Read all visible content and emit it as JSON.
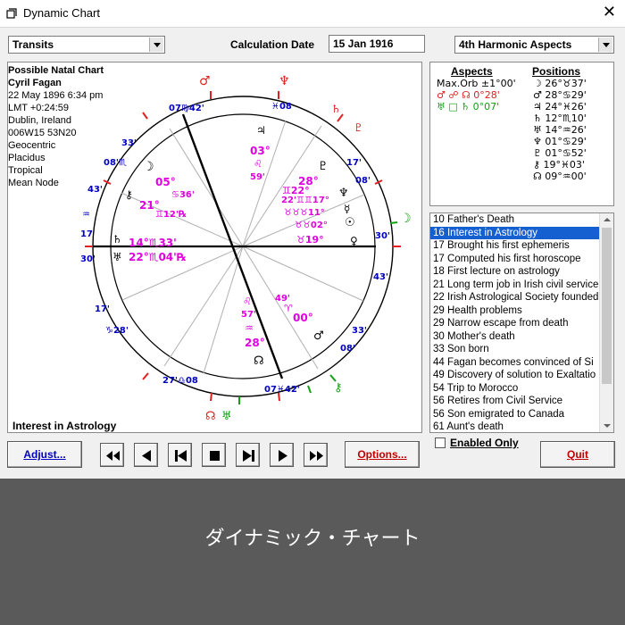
{
  "window": {
    "title": "Dynamic Chart",
    "close": "✕"
  },
  "toolbar": {
    "chart_type": "Transits",
    "calc_date_label": "Calculation Date",
    "calc_date_value": "15 Jan 1916",
    "aspect_mode": "4th Harmonic Aspects"
  },
  "chart_info": {
    "heading": "Possible Natal Chart",
    "name": "Cyril Fagan",
    "lines": [
      "22 May 1896 6:34 pm",
      "LMT +0:24:59",
      "Dublin, Ireland",
      "006W15 53N20",
      "Geocentric",
      "Placidus",
      "Tropical",
      "Mean Node"
    ],
    "event_caption": "Interest in Astrology"
  },
  "wheel_labels": {
    "cusps_outer": [
      {
        "deg": "07°",
        "sign": "♍",
        "min": "42'"
      },
      {
        "deg": "07°",
        "sign": "♓",
        "min": "42'"
      },
      {
        "deg": "17°",
        "sign": "♍",
        "min": "28'"
      },
      {
        "deg": "17°",
        "sign": "♓",
        "min": "28'"
      },
      {
        "deg": "30°",
        "sign": "♒",
        "min": ""
      },
      {
        "deg": "30°",
        "sign": "♌",
        "min": ""
      },
      {
        "deg": "43°",
        "sign": "♒",
        "min": ""
      },
      {
        "deg": "33°",
        "sign": "♏",
        "min": "08°"
      },
      {
        "deg": "27°",
        "sign": "♎",
        "min": ""
      },
      {
        "deg": "27°",
        "sign": "♈",
        "min": ""
      },
      {
        "deg": "33°",
        "sign": "♊",
        "min": "08°"
      },
      {
        "deg": "43°",
        "sign": "♌",
        "min": ""
      }
    ],
    "inner_magenta": [
      {
        "text": "03°",
        "sign": "♌",
        "min": "59'"
      },
      {
        "text": "05°",
        "sign": "♋",
        "min": "36'"
      },
      {
        "text": "21°",
        "sign": "♊",
        "min": "12'℞"
      },
      {
        "text": "14°",
        "sign": "♏",
        "min": "33'"
      },
      {
        "text": "22°",
        "sign": "♏",
        "min": "04'℞"
      },
      {
        "text": "28°",
        "sign": "♉",
        "min": ""
      },
      {
        "text": "22°",
        "sign": "♉",
        "min": ""
      },
      {
        "text": "17°",
        "sign": "♉",
        "min": ""
      },
      {
        "text": "11°",
        "sign": "♉",
        "min": ""
      },
      {
        "text": "02°",
        "sign": "♉",
        "min": ""
      },
      {
        "text": "19°",
        "sign": "♉",
        "min": ""
      },
      {
        "text": "49°",
        "sign": "♈",
        "min": "00°"
      },
      {
        "text": "57'",
        "sign": "♒",
        "min": "28°"
      }
    ]
  },
  "aspects": {
    "header_aspects": "Aspects",
    "header_positions": "Positions",
    "rows": [
      "Max.Orb ±1°00'",
      "♂ ☍ ☊  0°28'",
      "♅ □ ♄  0°07'"
    ],
    "positions": [
      "☽ 26°♉37'",
      "♂ 28°♋29'",
      "♃ 24°♓26'",
      "♄ 12°♏10'",
      "♅ 14°♒26'",
      "♆ 01°♋29'",
      "♇ 01°♋52'",
      "⚷ 19°♓03'",
      "☊ 09°♒00'"
    ]
  },
  "events": [
    "10 Father's Death",
    "16 Interest in Astrology",
    "17 Brought his first ephemeris",
    "17 Computed his first horoscope",
    "18 First lecture on astrology",
    "21 Long term job in Irish civil service",
    "22 Irish Astrological Society founded",
    "29 Health problems",
    "29 Narrow escape from death",
    "30 Mother's death",
    "33 Son born",
    "44 Fagan becomes convinced of Si",
    "49 Discovery of solution to Exaltatio",
    "54 Trip to Morocco",
    "56 Retires from Civil Service",
    "56 Son emigrated to Canada",
    "61 Aunt's death"
  ],
  "selected_event_index": 1,
  "buttons": {
    "adjust": "Adjust...",
    "options": "Options...",
    "quit": "Quit",
    "enabled_only": "Enabled Only"
  },
  "caption": "ダイナミック・チャート",
  "colors": {
    "accent": "#1560d0",
    "magenta": "#e000e0",
    "red": "#e02020",
    "green": "#10a010",
    "blue": "#0000c0"
  }
}
